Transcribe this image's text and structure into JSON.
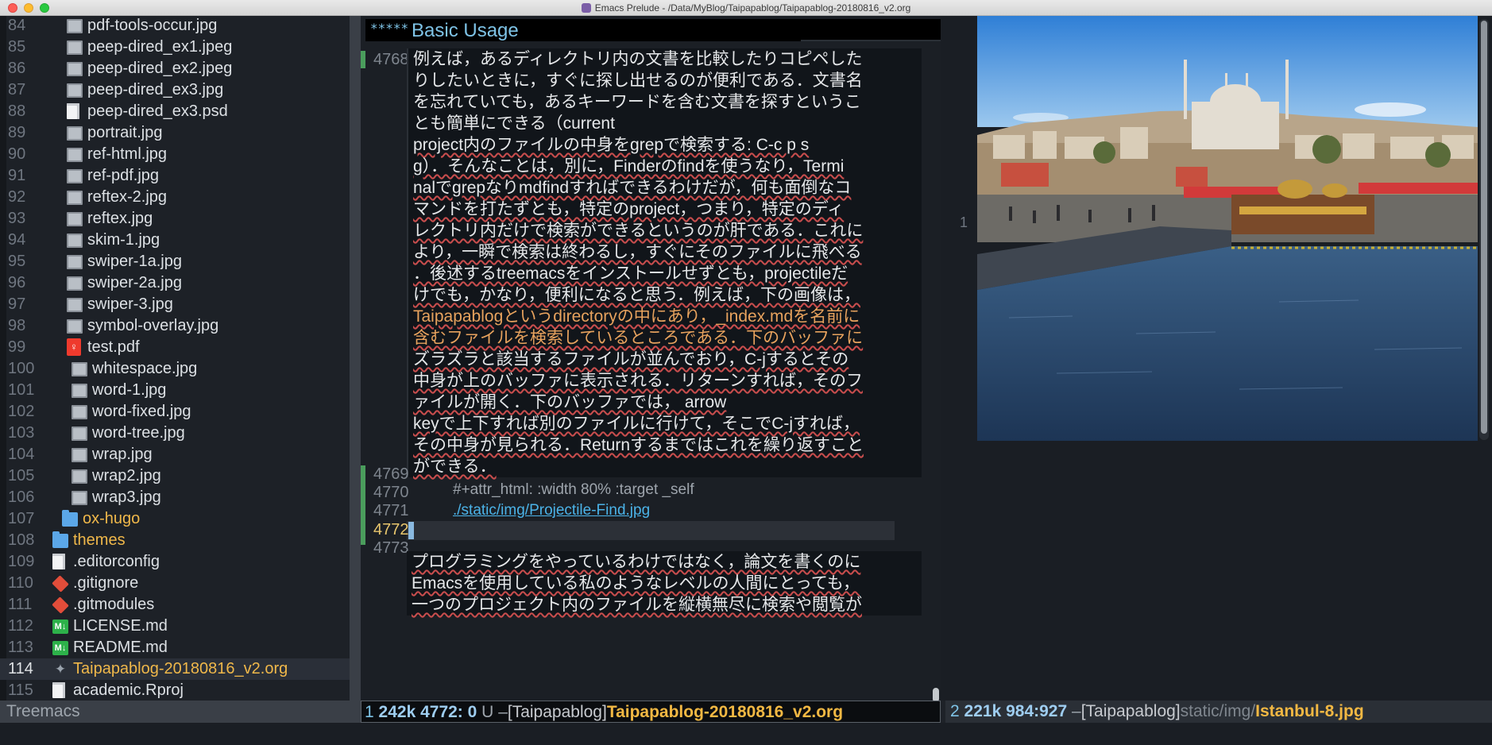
{
  "window": {
    "title": "Emacs Prelude - /Data/MyBlog/Taipapablog/Taipapablog-20180816_v2.org"
  },
  "treemacs": {
    "rows": [
      {
        "num": "84",
        "name": "pdf-tools-occur.jpg",
        "icon": "image-file-icon"
      },
      {
        "num": "85",
        "name": "peep-dired_ex1.jpeg",
        "icon": "image-file-icon"
      },
      {
        "num": "86",
        "name": "peep-dired_ex2.jpeg",
        "icon": "image-file-icon"
      },
      {
        "num": "87",
        "name": "peep-dired_ex3.jpg",
        "icon": "image-file-icon"
      },
      {
        "num": "88",
        "name": "peep-dired_ex3.psd",
        "icon": "document-file-icon"
      },
      {
        "num": "89",
        "name": "portrait.jpg",
        "icon": "image-file-icon"
      },
      {
        "num": "90",
        "name": "ref-html.jpg",
        "icon": "image-file-icon"
      },
      {
        "num": "91",
        "name": "ref-pdf.jpg",
        "icon": "image-file-icon"
      },
      {
        "num": "92",
        "name": "reftex-2.jpg",
        "icon": "image-file-icon"
      },
      {
        "num": "93",
        "name": "reftex.jpg",
        "icon": "image-file-icon"
      },
      {
        "num": "94",
        "name": "skim-1.jpg",
        "icon": "image-file-icon"
      },
      {
        "num": "95",
        "name": "swiper-1a.jpg",
        "icon": "image-file-icon"
      },
      {
        "num": "96",
        "name": "swiper-2a.jpg",
        "icon": "image-file-icon"
      },
      {
        "num": "97",
        "name": "swiper-3.jpg",
        "icon": "image-file-icon"
      },
      {
        "num": "98",
        "name": "symbol-overlay.jpg",
        "icon": "image-file-icon"
      },
      {
        "num": "99",
        "name": "test.pdf",
        "icon": "pdf-file-icon"
      },
      {
        "num": "100",
        "name": "whitespace.jpg",
        "icon": "image-file-icon"
      },
      {
        "num": "101",
        "name": "word-1.jpg",
        "icon": "image-file-icon"
      },
      {
        "num": "102",
        "name": "word-fixed.jpg",
        "icon": "image-file-icon"
      },
      {
        "num": "103",
        "name": "word-tree.jpg",
        "icon": "image-file-icon"
      },
      {
        "num": "104",
        "name": "wrap.jpg",
        "icon": "image-file-icon"
      },
      {
        "num": "105",
        "name": "wrap2.jpg",
        "icon": "image-file-icon"
      },
      {
        "num": "106",
        "name": "wrap3.jpg",
        "icon": "image-file-icon"
      },
      {
        "num": "107",
        "name": "ox-hugo",
        "icon": "folder-icon"
      },
      {
        "num": "108",
        "name": "themes",
        "icon": "folder-icon"
      },
      {
        "num": "109",
        "name": ".editorconfig",
        "icon": "document-file-icon"
      },
      {
        "num": "110",
        "name": ".gitignore",
        "icon": "git-icon"
      },
      {
        "num": "111",
        "name": ".gitmodules",
        "icon": "git-icon"
      },
      {
        "num": "112",
        "name": "LICENSE.md",
        "icon": "markdown-icon"
      },
      {
        "num": "113",
        "name": "README.md",
        "icon": "markdown-icon"
      },
      {
        "num": "114",
        "name": "Taipapablog-20180816_v2.org",
        "icon": "org-file-icon"
      },
      {
        "num": "115",
        "name": "academic.Rproj",
        "icon": "document-file-icon"
      }
    ]
  },
  "org": {
    "heading_stars": "*****",
    "heading": "Basic Usage",
    "ln_4768": "4768",
    "ln_4769": "4769",
    "ln_4770": "4770",
    "ln_4771": "4771",
    "ln_4772": "4772",
    "ln_4773": "4773",
    "para1": [
      "例えば，あるディレクトリ内の文書を比較したりコピペした",
      "りしたいときに，すぐに探し出せるのが便利である．文書名",
      "を忘れていても，あるキーワードを含む文書を探すというこ",
      "とも簡単にできる（current",
      "project内のファイルの中身をgrepで検索する: C-c p s",
      "g）．そんなことは，別に，Finderのfindを使うなり，Termi",
      "nalでgrepなりmdfindすればできるわけだが，何も面倒なコ",
      "マンドを打たずとも，特定のproject，つまり，特定のディ",
      "レクトリ内だけで検索ができるというのが肝である．これに",
      "より，一瞬で検索は終わるし，すぐにそのファイルに飛べる",
      "．後述するtreemacsをインストールせずとも，projectileだ",
      "けでも，かなり，便利になると思う．例えば，下の画像は，",
      "Taipapablogというdirectoryの中にあり，_index.mdを名前に",
      "含むファイルを検索しているところである．下のバッファに",
      "ズラズラと該当するファイルが並んでおり，C-jするとその",
      "中身が上のバッファに表示される．リターンすれば，そのフ",
      "ァイルが開く．下のバッファでは， arrow",
      "keyで上下すれば別のファイルに行けて，そこでC-jすれば，",
      "その中身が見られる．Returnするまではこれを繰り返すこと",
      "ができる．"
    ],
    "attr_line": "#+attr_html: :width 80% :target _self",
    "image_link": "./static/img/Projectile-Find.jpg",
    "para2": [
      "プログラミングをやっているわけではなく，論文を書くのに",
      "Emacsを使用している私のようなレベルの人間にとっても，",
      "一つのプロジェクト内のファイルを縦横無尽に検索や閲覧が"
    ]
  },
  "imagepane": {
    "line_marker": "1",
    "image_name": "Istanbul-8.jpg"
  },
  "modeline": {
    "tree_label": "Treemacs",
    "mid": {
      "window_num": "1",
      "size": "242k",
      "position": "4772: 0",
      "state": "U",
      "sep": "–",
      "project": "[Taipapablog]",
      "file": "Taipapablog-20180816_v2.org"
    },
    "right": {
      "window_num": "2",
      "size": "221k",
      "position": "984:927",
      "sep": "–",
      "project": "[Taipapablog]",
      "path": "static/img/",
      "file": "Istanbul-8.jpg"
    }
  },
  "colors": {
    "accent_orange": "#f2b843",
    "link_blue": "#4bb3e8",
    "heading_blue": "#7ec3e6"
  }
}
